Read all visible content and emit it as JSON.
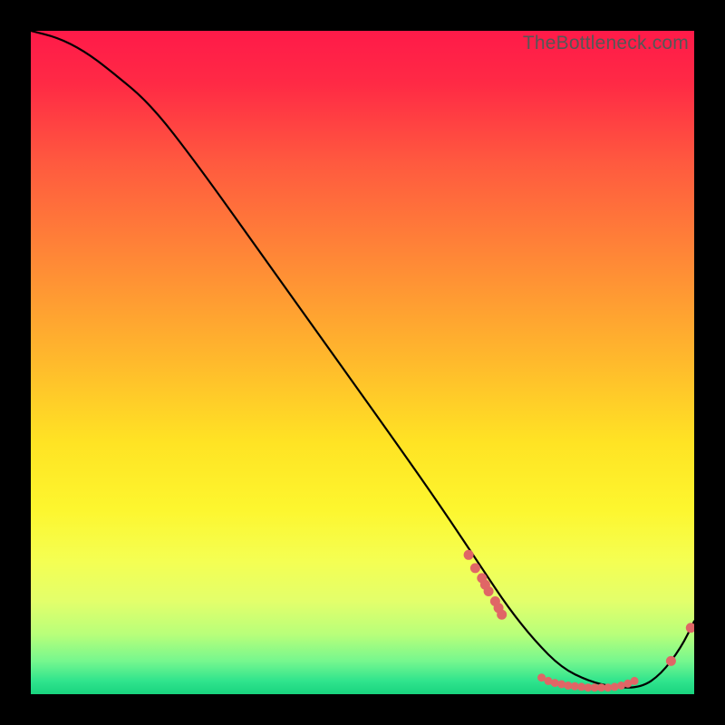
{
  "watermark": "TheBottleneck.com",
  "chart_data": {
    "type": "line",
    "title": "",
    "xlabel": "",
    "ylabel": "",
    "xlim": [
      0,
      100
    ],
    "ylim": [
      0,
      100
    ],
    "grid": false,
    "curve": {
      "x": [
        0,
        4,
        8,
        12,
        18,
        25,
        35,
        45,
        55,
        62,
        68,
        72,
        76,
        80,
        84,
        88,
        92,
        95,
        98,
        100
      ],
      "y": [
        100,
        99,
        97,
        94,
        89,
        80,
        66,
        52,
        38,
        28,
        19,
        13,
        8,
        4,
        2,
        1,
        1,
        3,
        7,
        11
      ]
    },
    "points_cluster_a": {
      "x": [
        66,
        67,
        68,
        68.5,
        69,
        70,
        70.5,
        71
      ],
      "y": [
        21,
        19,
        17.5,
        16.5,
        15.5,
        14,
        13,
        12
      ]
    },
    "points_cluster_b": {
      "x": [
        77,
        78,
        79,
        80,
        81,
        82,
        83,
        84,
        85,
        86,
        87,
        88,
        89,
        90,
        91
      ],
      "y": [
        2.5,
        2.0,
        1.7,
        1.5,
        1.3,
        1.2,
        1.1,
        1.0,
        1.0,
        1.0,
        1.0,
        1.1,
        1.3,
        1.6,
        2.0
      ]
    },
    "points_cluster_c": {
      "x": [
        96.5,
        99.5
      ],
      "y": [
        5,
        10
      ]
    }
  }
}
